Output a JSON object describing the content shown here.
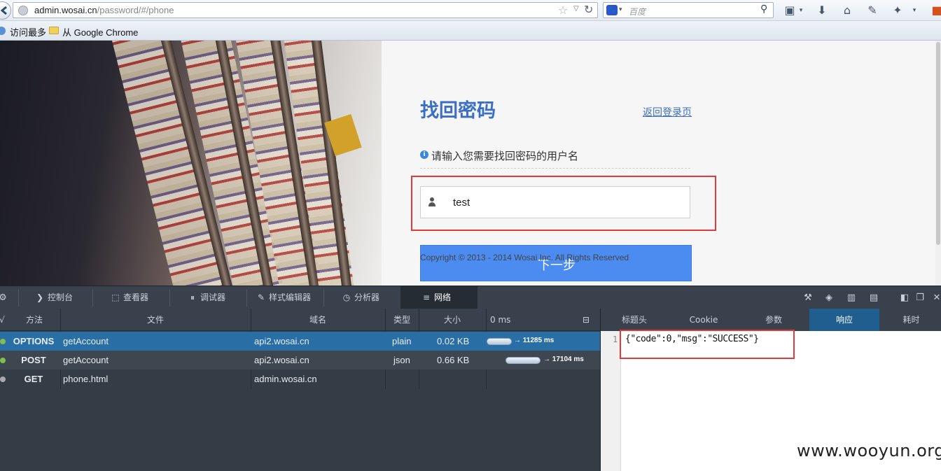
{
  "browser": {
    "url_host": "admin.wosai.cn",
    "url_path": "/password/#/phone",
    "search_placeholder": "百度",
    "bookmarks": [
      {
        "label": "访问最多"
      },
      {
        "label": "从 Google Chrome"
      }
    ]
  },
  "page": {
    "title": "找回密码",
    "back_link": "返回登录页",
    "hint": "请输入您需要找回密码的用户名",
    "username_value": "test",
    "next_button": "下一步",
    "copyright": "Copyright © 2013 - 2014 Wosai Inc. All Rights Reserved"
  },
  "devtools": {
    "tabs": [
      {
        "label": "控制台",
        "icon": "terminal-icon"
      },
      {
        "label": "查看器",
        "icon": "inspector-icon"
      },
      {
        "label": "调试器",
        "icon": "debugger-icon"
      },
      {
        "label": "样式编辑器",
        "icon": "style-editor-icon"
      },
      {
        "label": "分析器",
        "icon": "profiler-icon"
      },
      {
        "label": "网络",
        "icon": "network-icon"
      }
    ],
    "network": {
      "columns": [
        "√",
        "方法",
        "文件",
        "域名",
        "类型",
        "大小",
        "0 ms"
      ],
      "rows": [
        {
          "method": "OPTIONS",
          "file": "getAccount",
          "domain": "api2.wosai.cn",
          "type": "plain",
          "size": "0.02 KB",
          "time": "→ 11285 ms"
        },
        {
          "method": "POST",
          "file": "getAccount",
          "domain": "api2.wosai.cn",
          "type": "json",
          "size": "0.66 KB",
          "time": "→ 17104 ms"
        },
        {
          "method": "GET",
          "file": "phone.html",
          "domain": "admin.wosai.cn",
          "type": "",
          "size": "",
          "time": ""
        }
      ]
    },
    "response_tabs": [
      "标题头",
      "Cookie",
      "参数",
      "响应",
      "耗时"
    ],
    "response": {
      "line_number": "1",
      "body": "{\"code\":0,\"msg\":\"SUCCESS\"}"
    }
  },
  "watermark": "www.wooyun.org",
  "colors": {
    "accent": "#3a6fc4",
    "button": "#4c8cf0",
    "highlight_box": "#e23a3a",
    "devtools_bg": "#343c45",
    "selected_row": "#2a6ea6"
  }
}
